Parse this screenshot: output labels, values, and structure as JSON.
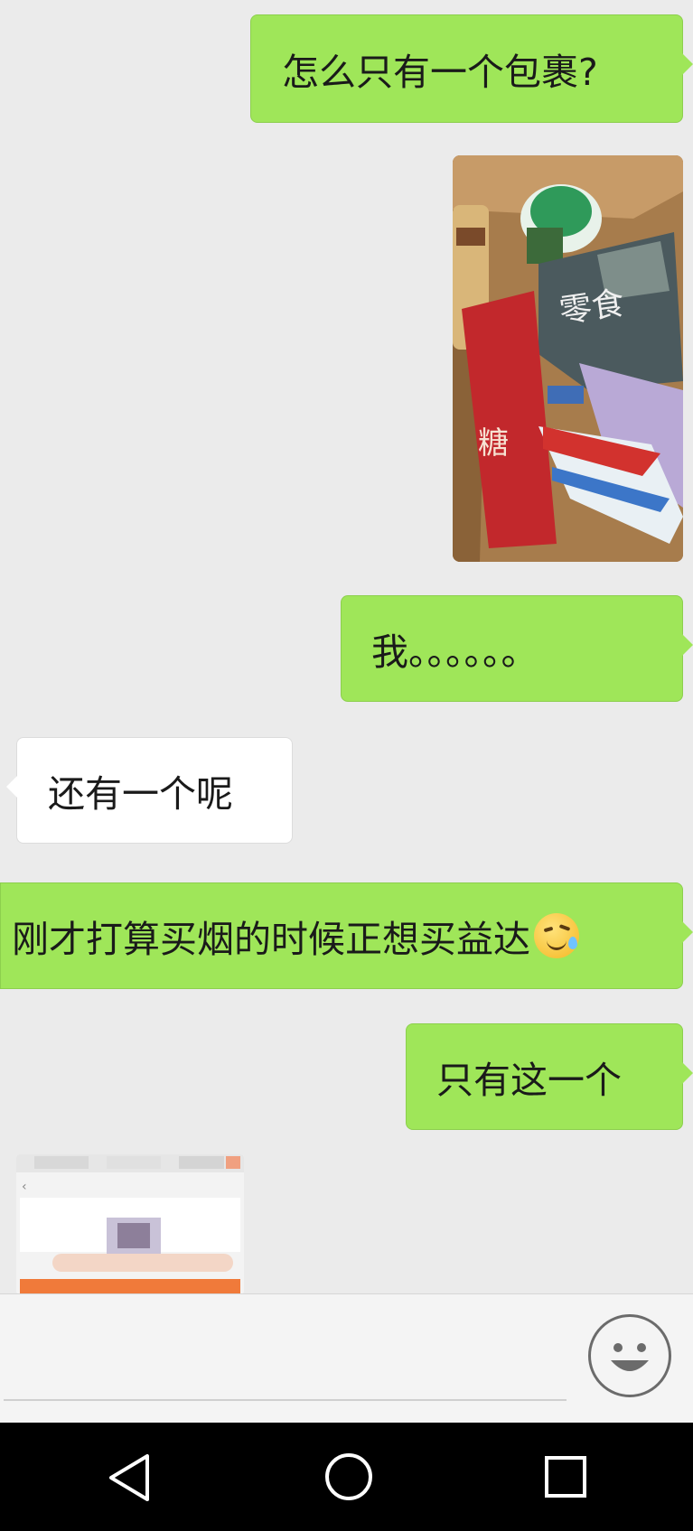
{
  "messages": [
    {
      "side": "right",
      "text": "怎么只有一个包裹?"
    },
    {
      "side": "right",
      "type": "image",
      "icon": "photo-of-snack-box"
    },
    {
      "side": "right",
      "text": "我。。。。。。"
    },
    {
      "side": "left",
      "text": "还有一个呢"
    },
    {
      "side": "right",
      "text": "刚才打算买烟的时候正想买益达",
      "emoji": "smirk-sweat-emoji"
    },
    {
      "side": "right",
      "text": "只有这一个"
    },
    {
      "side": "left",
      "type": "image",
      "icon": "blurred-screenshot-thumbnail"
    }
  ],
  "input_bar": {
    "emoji_button_icon": "smiley-face-icon"
  },
  "navigation_bar": {
    "back": "back-triangle-icon",
    "home": "home-circle-icon",
    "recents": "recents-square-icon"
  },
  "colors": {
    "sent_bubble": "#9fe659",
    "received_bubble": "#ffffff",
    "background": "#ebebeb",
    "nav_bar": "#000000"
  }
}
